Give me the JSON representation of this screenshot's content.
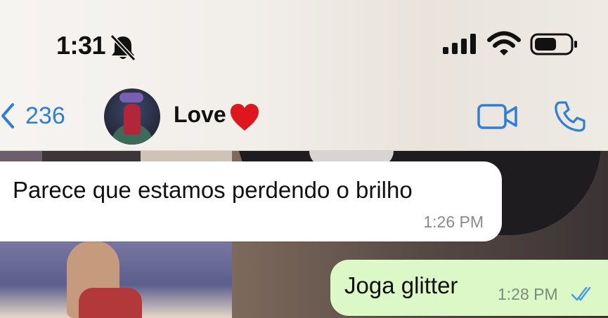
{
  "status_bar": {
    "time": "1:31",
    "icons": [
      "bell-off-icon",
      "signal-icon",
      "wifi-icon",
      "battery-icon"
    ]
  },
  "header": {
    "back_count": "236",
    "contact_name": "Love",
    "contact_emoji": "heart-icon",
    "actions": [
      "video-call-icon",
      "phone-call-icon"
    ],
    "accent_color": "#2f7fd7"
  },
  "messages": [
    {
      "direction": "incoming",
      "text": "Parece que estamos perdendo o brilho",
      "time": "1:26 PM"
    },
    {
      "direction": "outgoing",
      "text": "Joga glitter",
      "time": "1:28 PM",
      "status": "read-ticks-icon"
    }
  ],
  "colors": {
    "incoming_bubble": "#ffffff",
    "outgoing_bubble": "#dcf8c6",
    "heart": "#e0161e"
  }
}
